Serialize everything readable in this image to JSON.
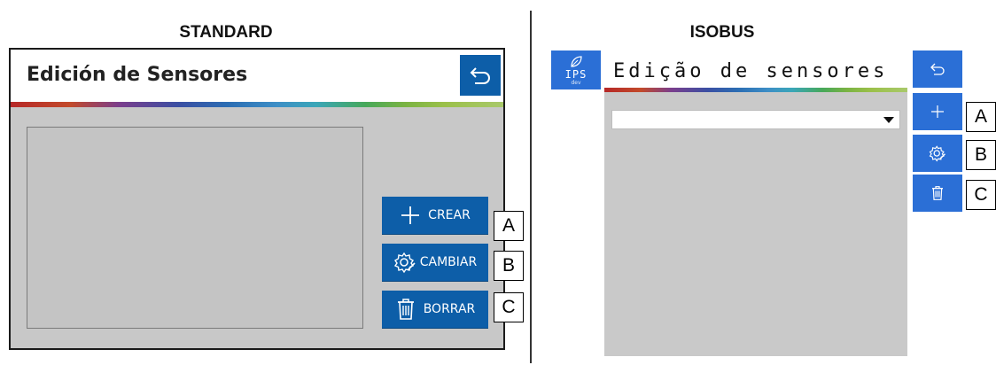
{
  "standard": {
    "heading": "STANDARD",
    "title": "Edición de Sensores",
    "back_icon": "back-arrow-icon",
    "buttons": [
      {
        "label": "CREAR",
        "icon": "plus-icon",
        "tag": "A"
      },
      {
        "label": "CAMBIAR",
        "icon": "gear-edit-icon",
        "tag": "B"
      },
      {
        "label": "BORRAR",
        "icon": "trash-icon",
        "tag": "C"
      }
    ]
  },
  "isobus": {
    "heading": "ISOBUS",
    "logo": {
      "text": "IPS",
      "subtext": "dev",
      "icon": "leaf-icon"
    },
    "title": "Edição de sensores",
    "dropdown_value": "",
    "buttons": [
      {
        "icon": "back-arrow-icon",
        "tag": ""
      },
      {
        "icon": "plus-icon",
        "tag": "A"
      },
      {
        "icon": "gear-edit-icon",
        "tag": "B"
      },
      {
        "icon": "trash-icon",
        "tag": "C"
      }
    ]
  },
  "colors": {
    "button_blue_standard": "#0d5ea8",
    "button_blue_isobus": "#2b6fd6",
    "panel_gray": "#c8c8c8"
  }
}
